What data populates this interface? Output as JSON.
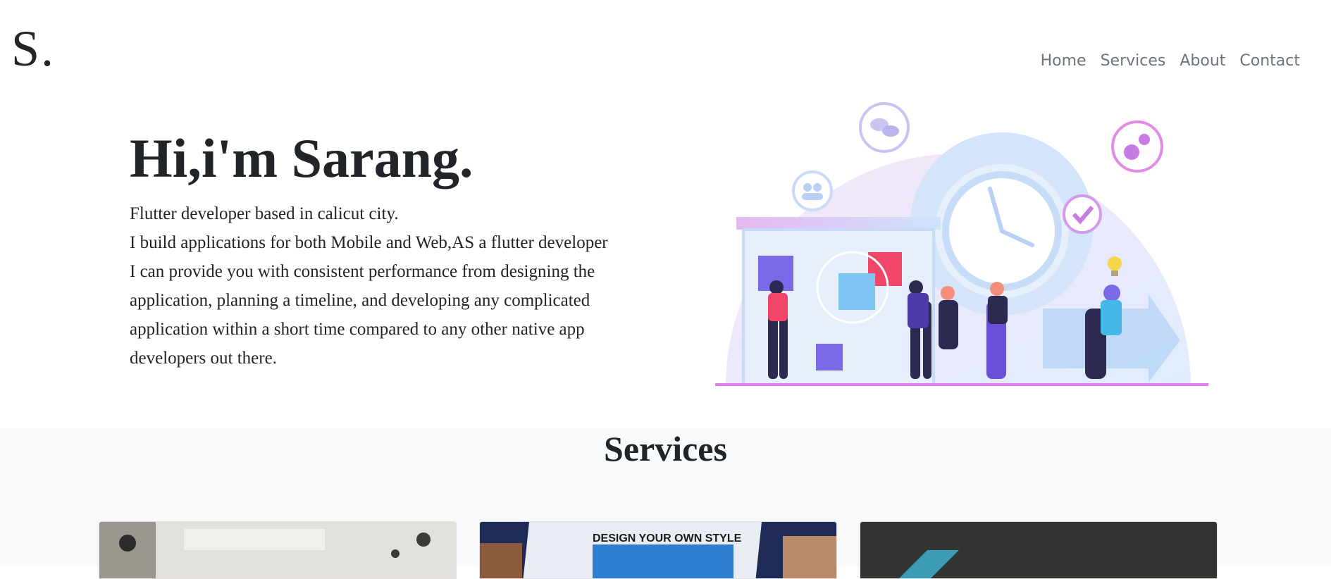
{
  "brand": {
    "logo_text": "S."
  },
  "nav": {
    "items": [
      {
        "label": "Home"
      },
      {
        "label": "Services"
      },
      {
        "label": "About"
      },
      {
        "label": "Contact"
      }
    ]
  },
  "hero": {
    "title": "Hi,i'm Sarang.",
    "tagline": "Flutter developer based in calicut city.",
    "description": "I build applications for both Mobile and Web,AS a flutter developer I can provide you with consistent performance from designing the application, planning a timeline, and developing any complicated application within a short time compared to any other native app developers out there.",
    "illustration_icons": [
      "chat-icon",
      "users-icon",
      "gears-icon",
      "check-icon",
      "lightbulb-icon",
      "clock-icon"
    ]
  },
  "services": {
    "title": "Services",
    "cards": [
      {
        "image": "office-photo"
      },
      {
        "image": "web-design-photo"
      },
      {
        "image": "dark-logo-image"
      }
    ]
  },
  "colors": {
    "text": "#212529",
    "nav": "#6c757d",
    "band": "#f8f9fa",
    "accent_purple": "#b57be0",
    "accent_blue": "#cfe3fb"
  }
}
